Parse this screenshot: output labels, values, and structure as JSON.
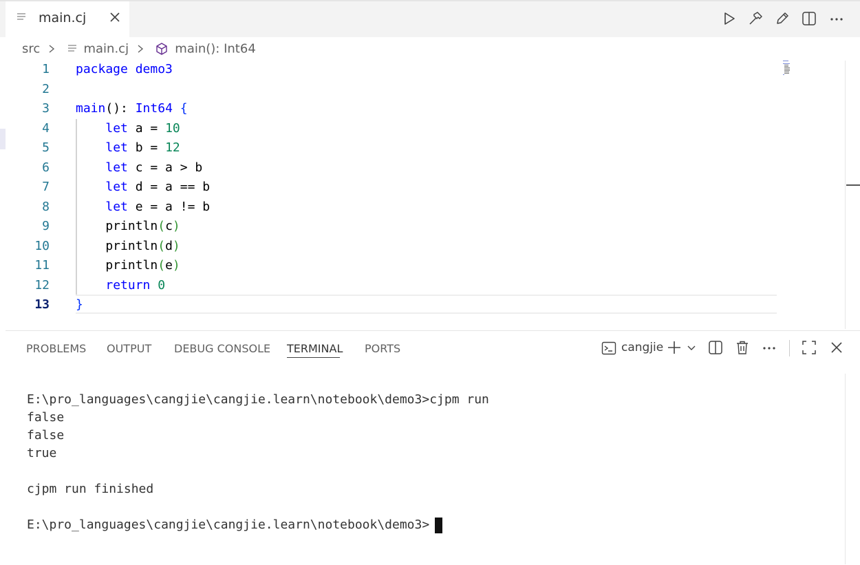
{
  "tab": {
    "label": "main.cj"
  },
  "breadcrumb": {
    "items": [
      "src",
      "main.cj",
      "main(): Int64"
    ]
  },
  "editor": {
    "lines": [
      {
        "n": "1",
        "tokens": [
          [
            "kw",
            "package"
          ],
          [
            "t",
            " "
          ],
          [
            "kw",
            "demo3"
          ]
        ]
      },
      {
        "n": "2",
        "tokens": []
      },
      {
        "n": "3",
        "tokens": [
          [
            "kw",
            "main"
          ],
          [
            "t",
            "(): "
          ],
          [
            "kw",
            "Int64"
          ],
          [
            "t",
            " "
          ],
          [
            "brace",
            "{"
          ]
        ]
      },
      {
        "n": "4",
        "tokens": [
          [
            "t",
            "    "
          ],
          [
            "kw",
            "let"
          ],
          [
            "t",
            " a = "
          ],
          [
            "num",
            "10"
          ]
        ]
      },
      {
        "n": "5",
        "tokens": [
          [
            "t",
            "    "
          ],
          [
            "kw",
            "let"
          ],
          [
            "t",
            " b = "
          ],
          [
            "num",
            "12"
          ]
        ]
      },
      {
        "n": "6",
        "tokens": [
          [
            "t",
            "    "
          ],
          [
            "kw",
            "let"
          ],
          [
            "t",
            " c = a > b"
          ]
        ]
      },
      {
        "n": "7",
        "tokens": [
          [
            "t",
            "    "
          ],
          [
            "kw",
            "let"
          ],
          [
            "t",
            " d = a == b"
          ]
        ]
      },
      {
        "n": "8",
        "tokens": [
          [
            "t",
            "    "
          ],
          [
            "kw",
            "let"
          ],
          [
            "t",
            " e = a != b"
          ]
        ]
      },
      {
        "n": "9",
        "tokens": [
          [
            "t",
            "    println"
          ],
          [
            "par",
            "("
          ],
          [
            "t",
            "c"
          ],
          [
            "par",
            ")"
          ]
        ]
      },
      {
        "n": "10",
        "tokens": [
          [
            "t",
            "    println"
          ],
          [
            "par",
            "("
          ],
          [
            "t",
            "d"
          ],
          [
            "par",
            ")"
          ]
        ]
      },
      {
        "n": "11",
        "tokens": [
          [
            "t",
            "    println"
          ],
          [
            "par",
            "("
          ],
          [
            "t",
            "e"
          ],
          [
            "par",
            ")"
          ]
        ]
      },
      {
        "n": "12",
        "tokens": [
          [
            "t",
            "    "
          ],
          [
            "kw",
            "return"
          ],
          [
            "t",
            " "
          ],
          [
            "num",
            "0"
          ]
        ]
      },
      {
        "n": "13",
        "tokens": [
          [
            "brace",
            "}"
          ]
        ]
      }
    ]
  },
  "panel": {
    "tabs": [
      "PROBLEMS",
      "OUTPUT",
      "DEBUG CONSOLE",
      "TERMINAL",
      "PORTS"
    ],
    "active_tab": "TERMINAL",
    "terminal_name": "cangjie"
  },
  "terminal": {
    "lines": [
      "E:\\pro_languages\\cangjie\\cangjie.learn\\notebook\\demo3>cjpm run",
      "false",
      "false",
      "true",
      "",
      "cjpm run finished",
      "",
      "E:\\pro_languages\\cangjie\\cangjie.learn\\notebook\\demo3>"
    ]
  },
  "icons": {
    "run": "play-icon",
    "build": "hammer-icon",
    "edit": "pencil-icon",
    "split": "split-editor-icon",
    "more": "ellipsis-icon"
  }
}
